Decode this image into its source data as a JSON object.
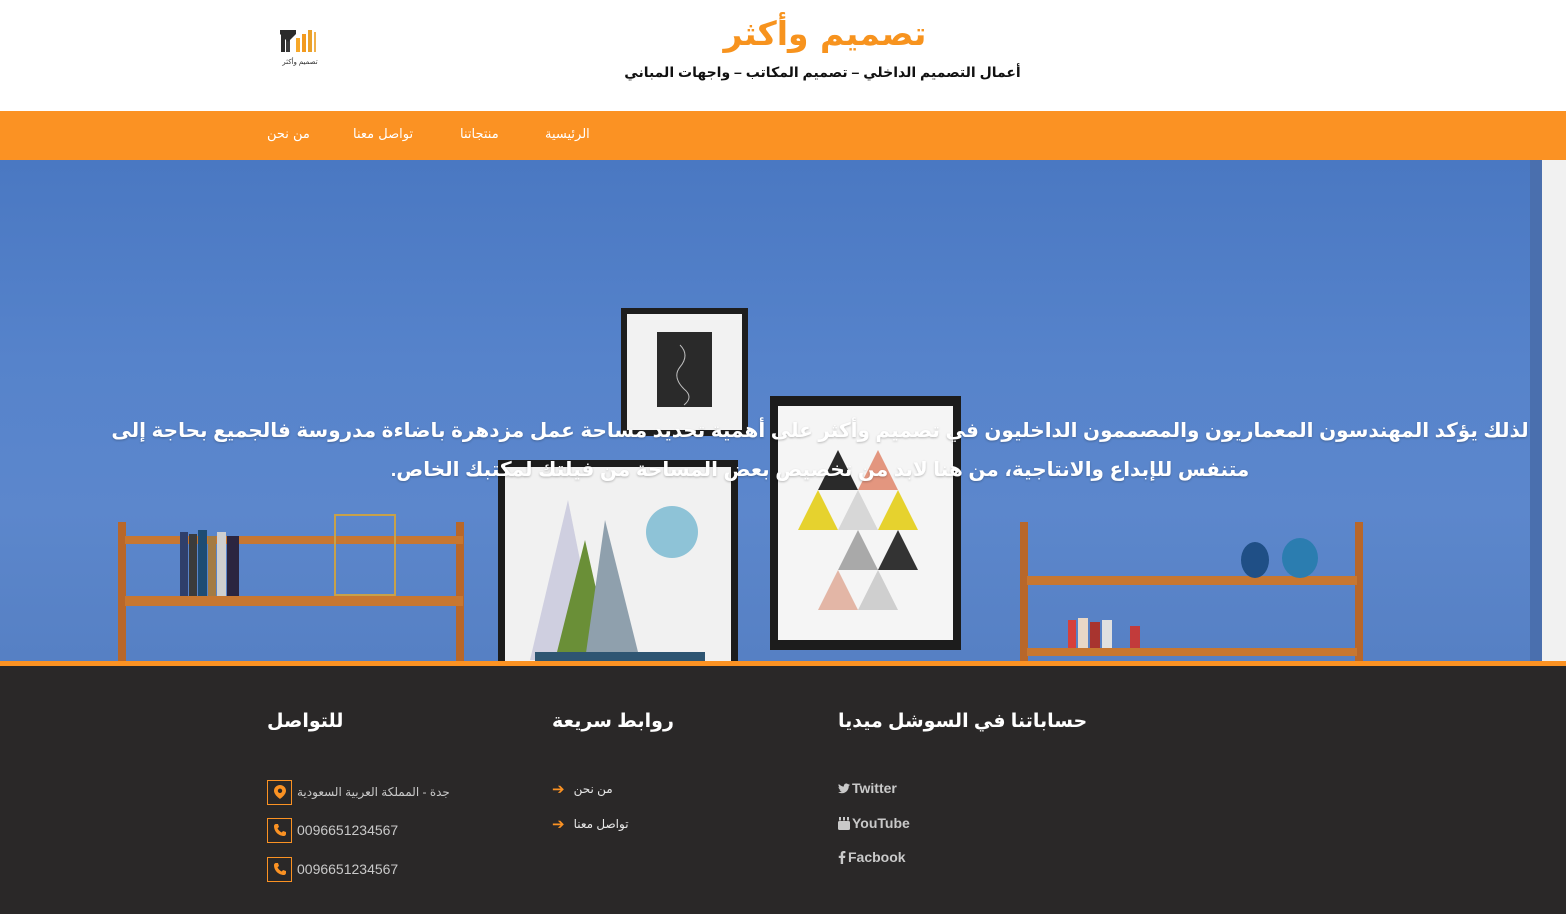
{
  "header": {
    "logo_caption": "تصميم وأكثر",
    "title": "تصميم وأكثر",
    "tagline": "أعمال التصميم الداخلي – تصميم المكاتب – واجهات المباني"
  },
  "nav": {
    "items": [
      {
        "label": "الرئيسية"
      },
      {
        "label": "منتجاتنا"
      },
      {
        "label": "تواصل معنا"
      },
      {
        "label": "من نحن"
      }
    ]
  },
  "hero": {
    "line1": "لذلك يؤكد المهندسون المعماريون والمصممون الداخليون في تصميم وأكثر على أهمية تحديد مساحة عمل مزدهرة باضاءة مدروسة فالجميع بحاجة إلى",
    "line2": "متنفس للإبداع والانتاجية، من هنا لابد من تخصيص بعض المساحة من فيلتك لمكتبك الخاص."
  },
  "footer": {
    "contact": {
      "heading": "للتواصل",
      "address": "جدة - المملكة العربية السعودية",
      "phone1": "0096651234567",
      "phone2": "0096651234567"
    },
    "quick_links": {
      "heading": "روابط سريعة",
      "items": [
        {
          "label": "من نحن"
        },
        {
          "label": "تواصل معنا"
        }
      ]
    },
    "social": {
      "heading": "حساباتنا في السوشل ميديا",
      "twitter": "Twitter",
      "youtube": "YouTube",
      "facebook": "Facbook"
    }
  },
  "colors": {
    "accent": "#fb9223",
    "footer_bg": "#2a2828",
    "hero_wall": "#5683cb"
  }
}
